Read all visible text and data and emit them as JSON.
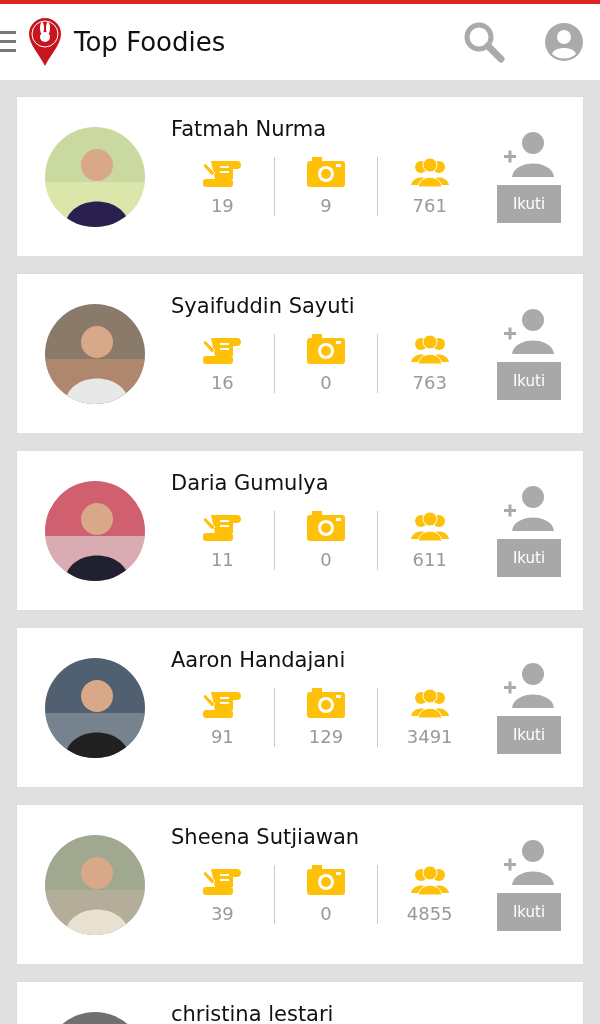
{
  "header": {
    "title": "Top Foodies"
  },
  "foodies": [
    {
      "name": "Fatmah Nurma",
      "reviews": "19",
      "photos": "9",
      "followers": "761",
      "follow_label": "Ikuti"
    },
    {
      "name": "Syaifuddin Sayuti",
      "reviews": "16",
      "photos": "0",
      "followers": "763",
      "follow_label": "Ikuti"
    },
    {
      "name": "Daria Gumulya",
      "reviews": "11",
      "photos": "0",
      "followers": "611",
      "follow_label": "Ikuti"
    },
    {
      "name": "Aaron Handajani",
      "reviews": "91",
      "photos": "129",
      "followers": "3491",
      "follow_label": "Ikuti"
    },
    {
      "name": "Sheena Sutjiawan",
      "reviews": "39",
      "photos": "0",
      "followers": "4855",
      "follow_label": "Ikuti"
    },
    {
      "name": "christina lestari"
    }
  ]
}
